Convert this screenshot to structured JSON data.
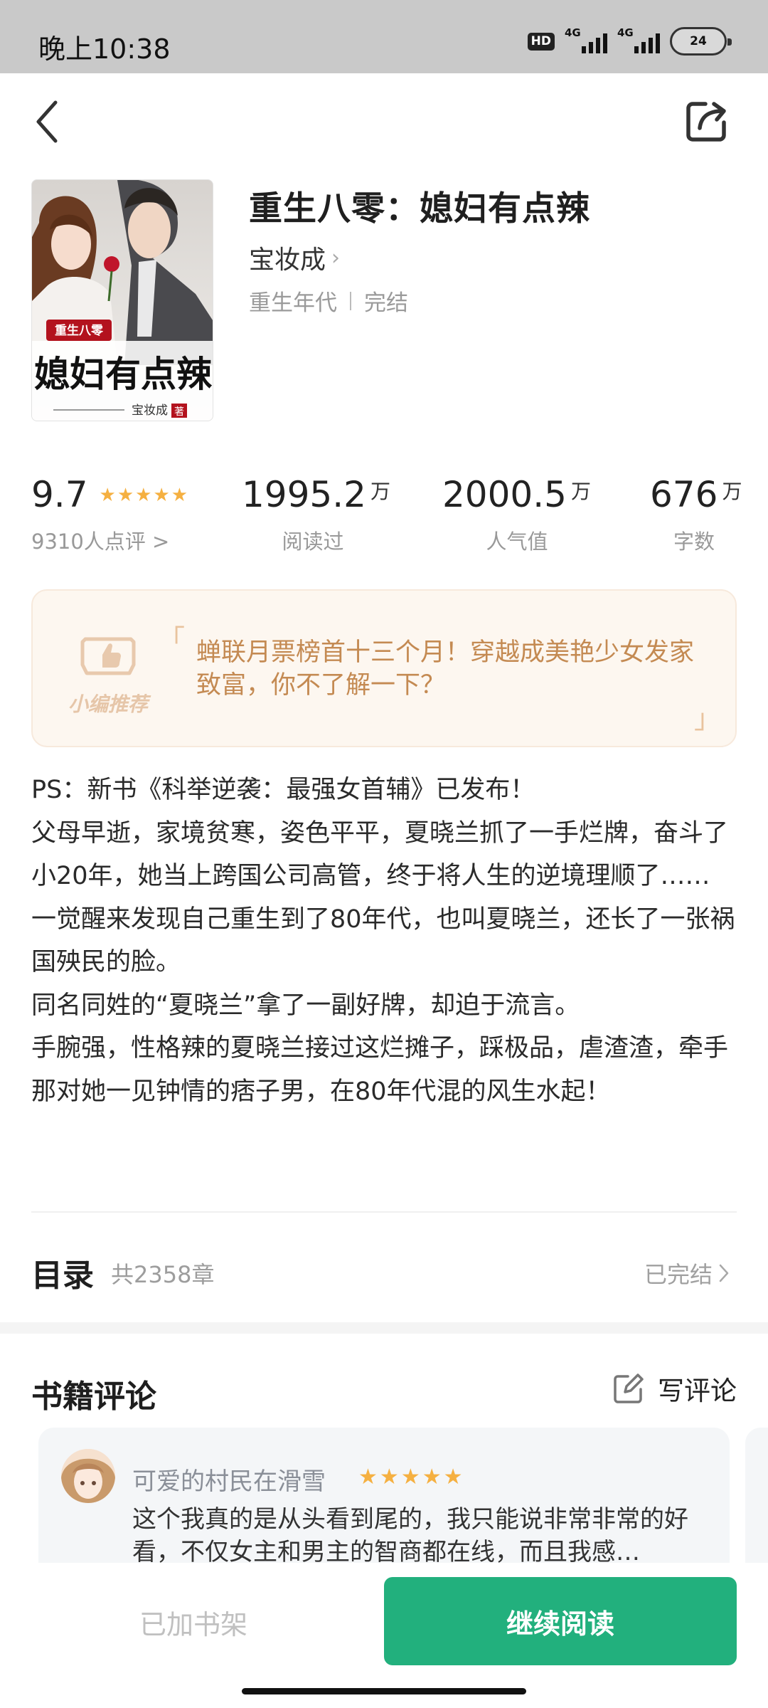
{
  "status_bar": {
    "time": "晚上10:38",
    "hd": "HD",
    "net1": "4G",
    "net2": "4G",
    "battery": "24"
  },
  "nav": {
    "back_icon": "chevron-left-icon",
    "share_icon": "share-icon"
  },
  "book": {
    "title": "重生八零：媳妇有点辣",
    "author": "宝妆成",
    "genre": "重生年代",
    "status": "完结",
    "cover": {
      "badge_text": "重生八零",
      "title_text": "媳妇有点辣",
      "author_text": "宝妆成",
      "author_suffix": "著"
    }
  },
  "stats": {
    "rating": {
      "value": "9.7",
      "stars": 5,
      "label": "9310人点评 >"
    },
    "reads": {
      "value": "1995.2",
      "unit": "万",
      "label": "阅读过"
    },
    "popularity": {
      "value": "2000.5",
      "unit": "万",
      "label": "人气值"
    },
    "words": {
      "value": "676",
      "unit": "万",
      "label": "字数"
    }
  },
  "recommend": {
    "badge": "小编推荐",
    "open_quote": "「",
    "close_quote": "」",
    "text": "蝉联月票榜首十三个月！穿越成美艳少女发家致富，你不了解一下？"
  },
  "description": [
    "PS：新书《科举逆袭：最强女首辅》已发布！",
    "父母早逝，家境贫寒，姿色平平，夏晓兰抓了一手烂牌，奋斗了小20年，她当上跨国公司高管，终于将人生的逆境理顺了……",
    "一觉醒来发现自己重生到了80年代，也叫夏晓兰，还长了一张祸国殃民的脸。",
    "同名同姓的“夏晓兰”拿了一副好牌，却迫于流言。",
    "手腕强，性格辣的夏晓兰接过这烂摊子，踩极品，虐渣渣，牵手那对她一见钟情的痞子男，在80年代混的风生水起！"
  ],
  "toc": {
    "title": "目录",
    "count": "共2358章",
    "status": "已完结"
  },
  "comments": {
    "title": "书籍评论",
    "write_label": "写评论",
    "items": [
      {
        "user": "可爱的村民在滑雪",
        "stars": 5,
        "text": "这个我真的是从头看到尾的，我只能说非常非常的好看，不仅女主和男主的智商都在线，而且我感…"
      }
    ]
  },
  "actions": {
    "shelf_label": "已加书架",
    "read_label": "继续阅读"
  },
  "colors": {
    "accent": "#22b07d",
    "star": "#f5b041",
    "recommend_text": "#c48a52",
    "recommend_bg": "#fdf7f0"
  }
}
